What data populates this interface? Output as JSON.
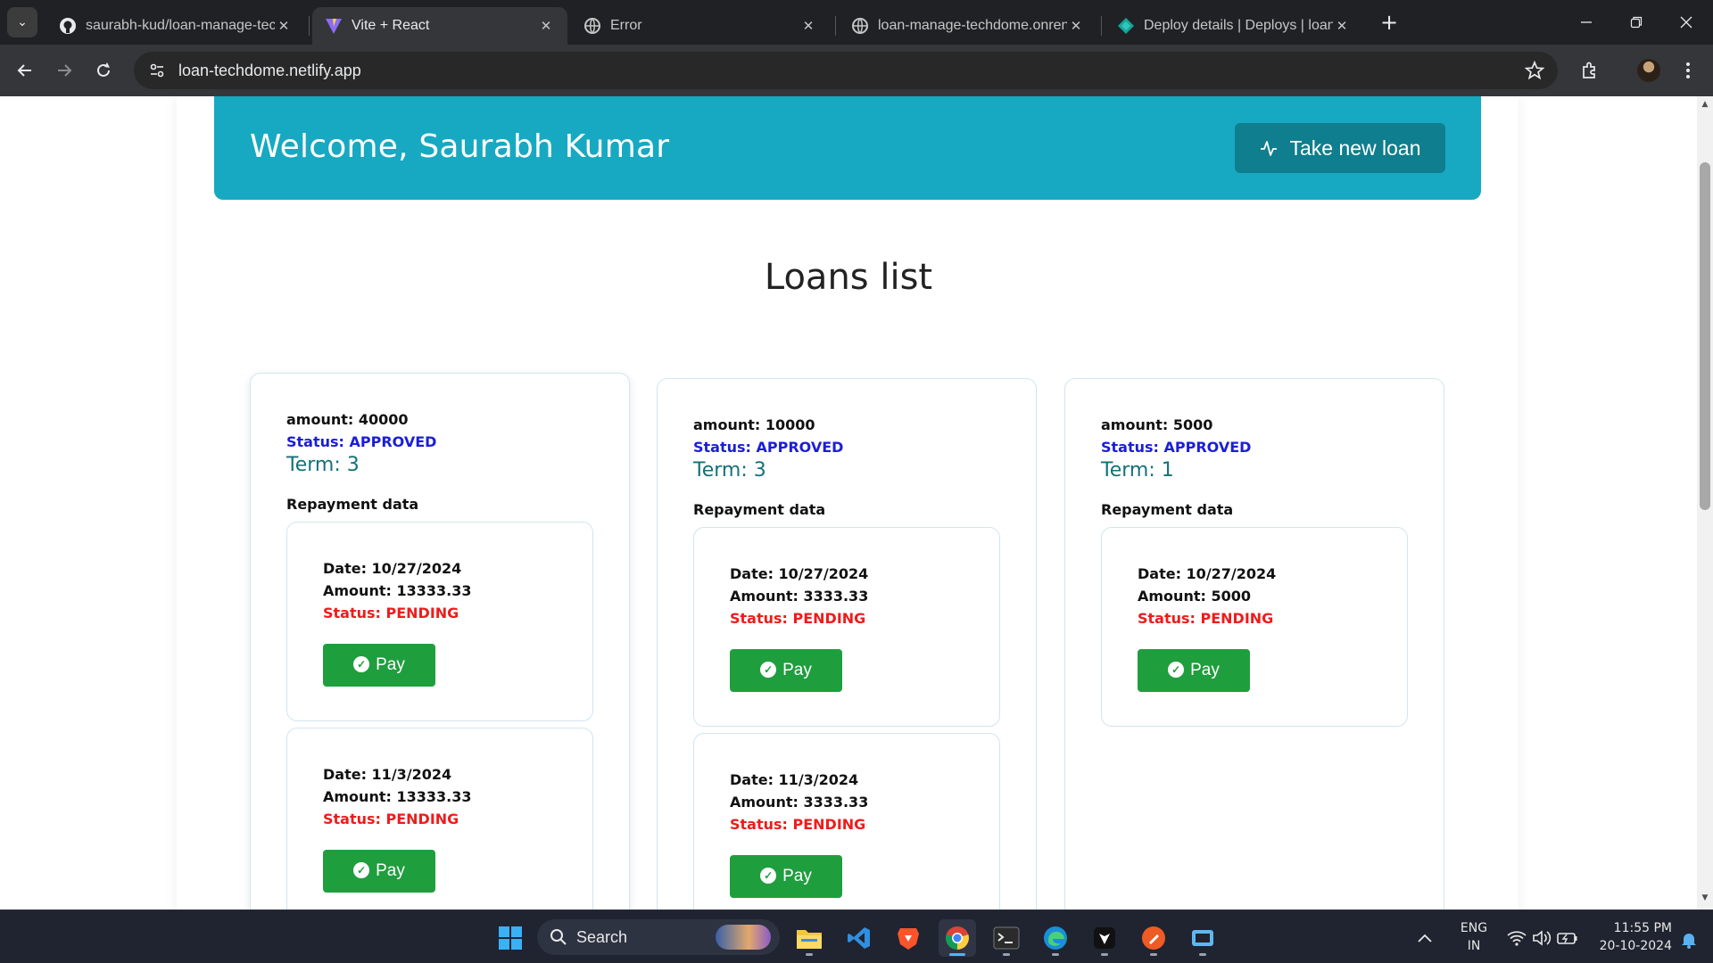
{
  "browser": {
    "tabs": [
      {
        "title": "saurabh-kud/loan-manage-tech",
        "icon": "github-icon",
        "active": false
      },
      {
        "title": "Vite + React",
        "icon": "vite-icon",
        "active": true
      },
      {
        "title": "Error",
        "icon": "globe-icon",
        "active": false
      },
      {
        "title": "loan-manage-techdome.onrender",
        "icon": "globe-icon",
        "active": false
      },
      {
        "title": "Deploy details | Deploys | loan-t",
        "icon": "netlify-icon",
        "active": false
      }
    ],
    "url": "loan-techdome.netlify.app"
  },
  "header": {
    "welcome_text": "Welcome, Saurabh Kumar",
    "new_loan_label": "Take new loan"
  },
  "main": {
    "title": "Loans list"
  },
  "loans": [
    {
      "amount": "amount: 40000",
      "status": "Status: APPROVED",
      "term": "Term: 3",
      "repayment_label": "Repayment data",
      "repayments": [
        {
          "date": "Date: 10/27/2024",
          "amount": "Amount: 13333.33",
          "status": "Status: PENDING",
          "pay_label": "Pay"
        },
        {
          "date": "Date: 11/3/2024",
          "amount": "Amount: 13333.33",
          "status": "Status: PENDING",
          "pay_label": "Pay"
        }
      ]
    },
    {
      "amount": "amount: 10000",
      "status": "Status: APPROVED",
      "term": "Term: 3",
      "repayment_label": "Repayment data",
      "repayments": [
        {
          "date": "Date: 10/27/2024",
          "amount": "Amount: 3333.33",
          "status": "Status: PENDING",
          "pay_label": "Pay"
        },
        {
          "date": "Date: 11/3/2024",
          "amount": "Amount: 3333.33",
          "status": "Status: PENDING",
          "pay_label": "Pay"
        }
      ]
    },
    {
      "amount": "amount: 5000",
      "status": "Status: APPROVED",
      "term": "Term: 1",
      "repayment_label": "Repayment data",
      "repayments": [
        {
          "date": "Date: 10/27/2024",
          "amount": "Amount: 5000",
          "status": "Status: PENDING",
          "pay_label": "Pay"
        }
      ]
    }
  ],
  "taskbar": {
    "search_label": "Search",
    "apps": [
      "start-icon",
      "file-explorer-icon",
      "vscode-icon",
      "brave-icon",
      "chrome-icon",
      "terminal-icon",
      "edge-icon",
      "app-icon",
      "postman-icon",
      "app-icon"
    ],
    "lang_1": "ENG",
    "lang_2": "IN",
    "time": "11:55 PM",
    "date": "20-10-2024"
  },
  "colors": {
    "banner": "#17a9c1",
    "new_loan_button": "#0f7e8e",
    "approved": "#1b1ed8",
    "pending": "#ee1c1c",
    "term": "#137179",
    "pay_button": "#1f9e3e"
  }
}
